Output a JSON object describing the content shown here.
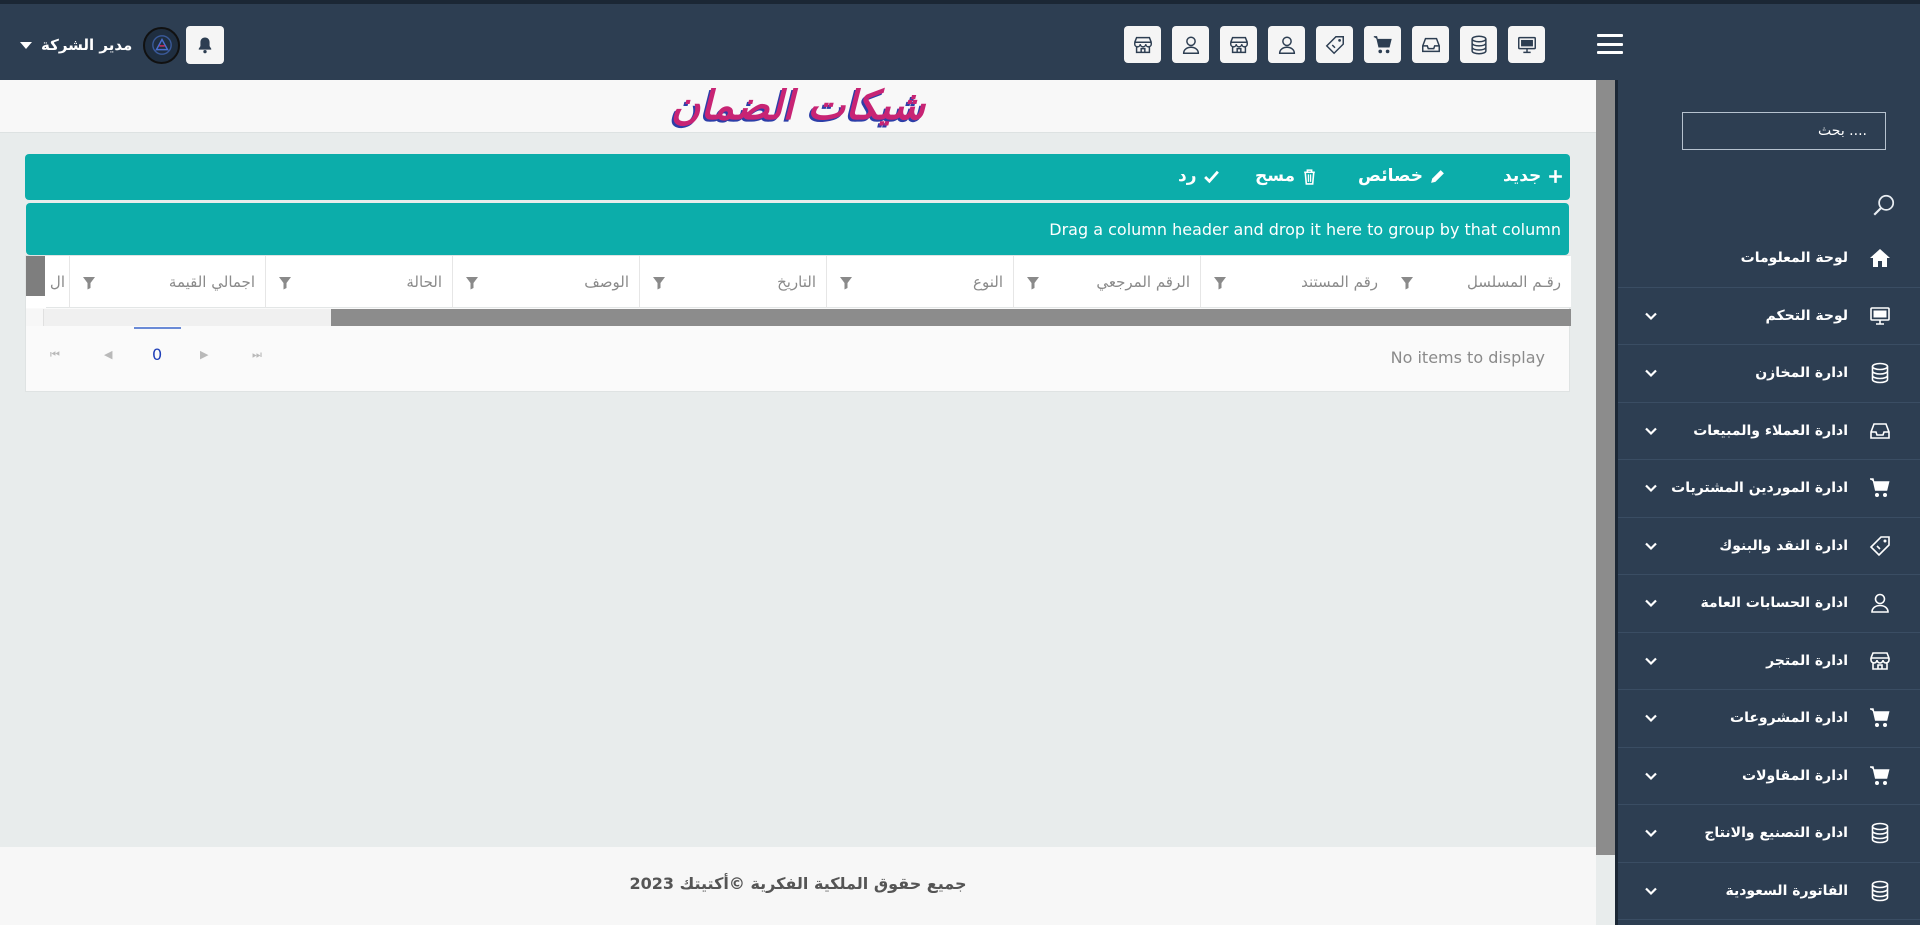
{
  "topbar": {
    "user_name": "مدير الشركة",
    "icons": [
      "monitor-icon",
      "database-icon",
      "inbox-icon",
      "cart-icon",
      "tag-icon",
      "user-icon",
      "store-icon",
      "user-icon",
      "store-icon"
    ]
  },
  "sidebar": {
    "search_placeholder": "بحث ....",
    "items": [
      {
        "label": "لوحة المعلومات",
        "icon": "home-icon",
        "has_submenu": false
      },
      {
        "label": "لوحة التحكم",
        "icon": "monitor-icon",
        "has_submenu": true
      },
      {
        "label": "ادارة المخازن",
        "icon": "database-icon",
        "has_submenu": true
      },
      {
        "label": "ادارة العملاء والمبيعات",
        "icon": "inbox-icon",
        "has_submenu": true
      },
      {
        "label": "ادارة الموردين المشتريات",
        "icon": "cart-icon",
        "has_submenu": true
      },
      {
        "label": "ادارة النقد والبنوك",
        "icon": "tag-icon",
        "has_submenu": true
      },
      {
        "label": "ادارة الحسابات العامة",
        "icon": "user-icon",
        "has_submenu": true
      },
      {
        "label": "ادارة المتجر",
        "icon": "store-icon",
        "has_submenu": true
      },
      {
        "label": "ادارة المشروعات",
        "icon": "cart-icon",
        "has_submenu": true
      },
      {
        "label": "ادارة المقاولات",
        "icon": "cart-icon",
        "has_submenu": true
      },
      {
        "label": "ادارة التصنيع والانتاج",
        "icon": "database-icon",
        "has_submenu": true
      },
      {
        "label": "الفاتورة السعودية",
        "icon": "database-icon",
        "has_submenu": true
      }
    ]
  },
  "page": {
    "title": "شيكات الضمان"
  },
  "toolbar": {
    "new_label": "جديد",
    "properties_label": "خصائص",
    "delete_label": "مسح",
    "reply_label": "رد"
  },
  "grid": {
    "group_panel_text": "Drag a column header and drop it here to group by that column",
    "columns": [
      "رقـم المسلسل",
      "رقم المستند",
      "الرقم المرجعي",
      "النوع",
      "التاريخ",
      "الوصف",
      "الحالة",
      "اجمالي القيمة",
      "ال"
    ],
    "no_items": "No items to display",
    "current_page": "0"
  },
  "footer": {
    "text": "جميع حقوق الملكية الفكرية ©أكتيتك 2023"
  },
  "colors": {
    "nav_bg": "#2d3e52",
    "accent": "#0cadaa",
    "title": "#c82474"
  }
}
